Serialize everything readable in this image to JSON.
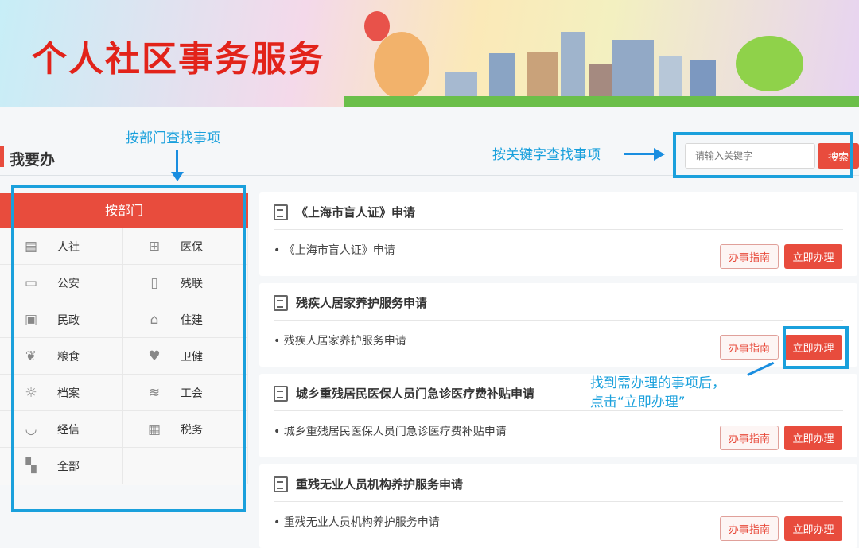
{
  "banner": {
    "title": "个人社区事务服务"
  },
  "section": {
    "title": "我要办"
  },
  "search": {
    "placeholder": "请输入关键字",
    "button": "搜索"
  },
  "dept": {
    "header": "按部门",
    "items": [
      {
        "label": "人社",
        "icon": "certificate-icon"
      },
      {
        "label": "医保",
        "icon": "medical-kit-icon"
      },
      {
        "label": "公安",
        "icon": "id-card-icon"
      },
      {
        "label": "残联",
        "icon": "book-icon"
      },
      {
        "label": "民政",
        "icon": "badge-icon"
      },
      {
        "label": "住建",
        "icon": "building-icon"
      },
      {
        "label": "粮食",
        "icon": "grain-icon"
      },
      {
        "label": "卫健",
        "icon": "health-icon"
      },
      {
        "label": "档案",
        "icon": "lightbulb-icon"
      },
      {
        "label": "工会",
        "icon": "layers-icon"
      },
      {
        "label": "经信",
        "icon": "inbox-icon"
      },
      {
        "label": "税务",
        "icon": "tax-doc-icon"
      },
      {
        "label": "全部",
        "icon": "grid-icon"
      }
    ]
  },
  "cards": [
    {
      "title": "《上海市盲人证》申请",
      "item": "• 《上海市盲人证》申请"
    },
    {
      "title": "残疾人居家养护服务申请",
      "item": "• 残疾人居家养护服务申请"
    },
    {
      "title": "城乡重残居民医保人员门急诊医疗费补贴申请",
      "item": "• 城乡重残居民医保人员门急诊医疗费补贴申请"
    },
    {
      "title": "重残无业人员机构养护服务申请",
      "item": "• 重残无业人员机构养护服务申请"
    }
  ],
  "buttons": {
    "guide": "办事指南",
    "apply": "立即办理"
  },
  "annotations": {
    "dept": "按部门查找事项",
    "keyword": "按关键字查找事项",
    "apply_line1": "找到需办理的事项后，",
    "apply_line2": "点击“立即办理”"
  },
  "colors": {
    "accent": "#e84c3d",
    "annotation": "#1aa0dc"
  }
}
